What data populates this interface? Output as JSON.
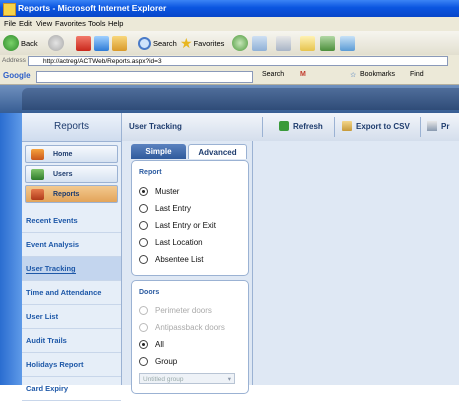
{
  "window": {
    "title": "Reports - Microsoft Internet Explorer"
  },
  "menu": [
    "File",
    "Edit",
    "View",
    "Favorites",
    "Tools",
    "Help"
  ],
  "browser_toolbar": {
    "back": "Back",
    "search": "Search",
    "favorites": "Favorites"
  },
  "address": {
    "label": "Address",
    "url": "http://actreg/ACTWeb/Reports.aspx?id=3"
  },
  "google_bar": {
    "logo": "Google",
    "search": "Search",
    "bookmarks": "Bookmarks",
    "find": "Find"
  },
  "sidebar": {
    "header": "Reports",
    "buttons": [
      {
        "label": "Home",
        "icon": "home-icon"
      },
      {
        "label": "Users",
        "icon": "users-icon"
      },
      {
        "label": "Reports",
        "icon": "reports-icon",
        "selected": true
      }
    ],
    "nav": [
      {
        "label": "Recent Events"
      },
      {
        "label": "Event Analysis"
      },
      {
        "label": "User Tracking",
        "selected": true
      },
      {
        "label": "Time and Attendance"
      },
      {
        "label": "User List"
      },
      {
        "label": "Audit Trails"
      },
      {
        "label": "Holidays Report"
      },
      {
        "label": "Card Expiry"
      }
    ]
  },
  "main": {
    "title": "User Tracking",
    "actions": {
      "refresh": "Refresh",
      "export": "Export to CSV",
      "print": "Pr"
    }
  },
  "panel": {
    "tabs": {
      "simple": "Simple",
      "advanced": "Advanced"
    },
    "report_group": {
      "label": "Report",
      "options": [
        "Muster",
        "Last Entry",
        "Last Entry or Exit",
        "Last Location",
        "Absentee List"
      ],
      "selected": "Muster"
    },
    "doors_group": {
      "label": "Doors",
      "options": [
        "Perimeter doors",
        "Antipassback doors",
        "All",
        "Group"
      ],
      "selected": "All",
      "disabled": [
        "Perimeter doors",
        "Antipassback doors"
      ],
      "dropdown_value": "Untitled group"
    }
  },
  "colors": {
    "ie_title": "#0a55e0",
    "sidebar_bg": "#e6eef8",
    "nav_link": "#1e58a8",
    "selected_button": "#e3a45a",
    "refresh_icon": "#3a9a3a"
  }
}
